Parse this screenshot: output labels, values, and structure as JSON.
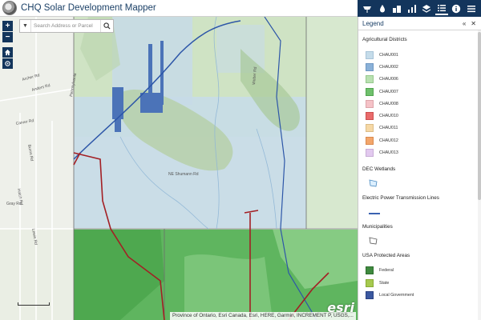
{
  "app": {
    "title": "CHQ Solar Development Mapper",
    "logo_icon": "county-seal-icon"
  },
  "toolbar": {
    "items": [
      {
        "name": "solar-tool-icon"
      },
      {
        "name": "layer-drop-icon"
      },
      {
        "name": "buildings-icon"
      },
      {
        "name": "chart-icon"
      },
      {
        "name": "layers-icon"
      },
      {
        "name": "legend-list-icon"
      },
      {
        "name": "info-icon"
      },
      {
        "name": "menu-icon"
      }
    ],
    "active": "legend-list-icon"
  },
  "search": {
    "placeholder": "Search Address or Parcel"
  },
  "map_controls": {
    "zoom_in": "+",
    "zoom_out": "−"
  },
  "map": {
    "attribution": "Province of Ontario, Esri Canada, Esri, HERE, Garmin, INCREMENT P, USGS,...",
    "esri_logo": "esri",
    "road_labels": [
      "Pennsylvania",
      "Archer Rd",
      "Anders Rd",
      "Carver Rd",
      "Burns Rd",
      "Hatch Rd",
      "Gray Rd",
      "Lewis Rd",
      "NE Shumann Rd",
      "Weber Rd"
    ]
  },
  "legend": {
    "title": "Legend",
    "sections": [
      {
        "title": "Agricultural Districts",
        "items": [
          {
            "label": "CHAU001",
            "color": "#c5dcea"
          },
          {
            "label": "CHAU002",
            "color": "#8ab1d8"
          },
          {
            "label": "CHAU006",
            "color": "#b9e1b1"
          },
          {
            "label": "CHAU007",
            "color": "#6fc06c"
          },
          {
            "label": "CHAU008",
            "color": "#f5c2c7"
          },
          {
            "label": "CHAU010",
            "color": "#e96b6b"
          },
          {
            "label": "CHAU011",
            "color": "#f6d8a5"
          },
          {
            "label": "CHAU012",
            "color": "#f3a66b"
          },
          {
            "label": "CHAU013",
            "color": "#e2c9ef"
          }
        ]
      },
      {
        "title": "DEC Wetlands",
        "type": "wetland"
      },
      {
        "title": "Electric Power Transmission Lines",
        "type": "line"
      },
      {
        "title": "Municipalities",
        "type": "municipality"
      },
      {
        "title": "USA Protected Areas",
        "items": [
          {
            "label": "Federal",
            "color": "#3f8a3f"
          },
          {
            "label": "State",
            "color": "#a6c94f"
          },
          {
            "label": "Local Government",
            "color": "#3b58a0"
          }
        ]
      }
    ]
  }
}
